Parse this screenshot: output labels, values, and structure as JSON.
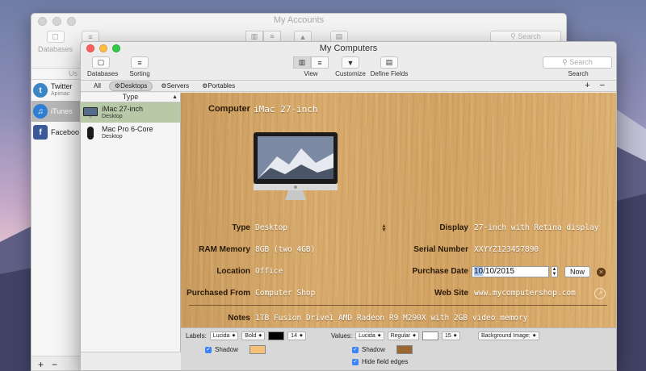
{
  "back_window": {
    "title": "My Accounts",
    "toolbar": {
      "databases_label": "Databases",
      "search_placeholder": "Search"
    },
    "list_header": "Us",
    "items": [
      {
        "name": "Twitter",
        "sub": "Apimac"
      },
      {
        "name": "iTunes",
        "sub": ""
      },
      {
        "name": "Faceboo",
        "sub": ""
      }
    ],
    "bottom": {
      "add": "+",
      "remove": "−"
    }
  },
  "window": {
    "title": "My Computers",
    "toolbar": {
      "databases": "Databases",
      "sorting": "Sorting",
      "view": "View",
      "customize": "Customize",
      "define_fields": "Define Fields",
      "search_placeholder": "Search",
      "search_label": "Search"
    },
    "filters": [
      "All",
      "Desktops",
      "Servers",
      "Portables"
    ],
    "filter_active": "Desktops",
    "add": "+",
    "remove": "−",
    "list": {
      "header": "Type",
      "items": [
        {
          "name": "iMac 27-inch",
          "sub": "Desktop",
          "selected": true
        },
        {
          "name": "Mac Pro 6-Core",
          "sub": "Desktop",
          "selected": false
        }
      ]
    },
    "detail": {
      "computer_label": "Computer",
      "computer_value": "iMac 27-inch",
      "type_label": "Type",
      "type_value": "Desktop",
      "ram_label": "RAM Memory",
      "ram_value": "8GB (two 4GB)",
      "location_label": "Location",
      "location_value": "Office",
      "purchased_from_label": "Purchased From",
      "purchased_from_value": "Computer Shop",
      "display_label": "Display",
      "display_value": "27-inch with Retina display",
      "serial_label": "Serial Number",
      "serial_value": "XXYYZ123457890",
      "purchase_date_label": "Purchase Date",
      "purchase_date_sel": "10",
      "purchase_date_rest": "/10/2015",
      "now_label": "Now",
      "website_label": "Web Site",
      "website_value": "www.mycomputershop.com",
      "notes_label": "Notes",
      "notes_value": "1TB Fusion Drive1 AMD Radeon R9 M290X with 2GB video memory"
    },
    "format_bar": {
      "labels_title": "Labels:",
      "labels_font": "Lucida",
      "labels_style": "Bold",
      "labels_size": "14",
      "labels_color": "#000000",
      "labels_shadow": "Shadow",
      "labels_shadow_color": "#f4c17a",
      "values_title": "Values:",
      "values_font": "Lucida",
      "values_style": "Regular",
      "values_size": "15",
      "values_color": "#ffffff",
      "values_shadow": "Shadow",
      "values_shadow_color": "#9a6632",
      "hide_edges": "Hide field edges",
      "background_image": "Background Image:"
    }
  }
}
